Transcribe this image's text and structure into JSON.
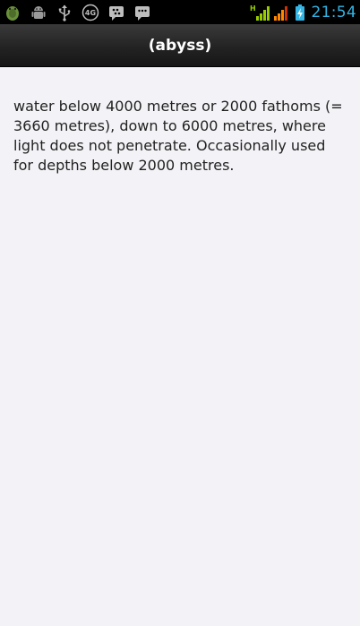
{
  "status_bar": {
    "left_icons": [
      "android-debug-icon",
      "android-robot-icon",
      "usb-icon",
      "4g-icon",
      "bbm-icon",
      "chat-icon"
    ],
    "network_label": "H",
    "time": "21:54",
    "battery_color": "#33b5e5",
    "signal_color": "#99cc00"
  },
  "title_bar": {
    "title": "(abyss)"
  },
  "content": {
    "definition": "water below 4000 metres or 2000 fathoms (= 3660 metres), down to 6000 metres, where light does not penetrate. Occasionally used for depths below 2000 metres."
  }
}
